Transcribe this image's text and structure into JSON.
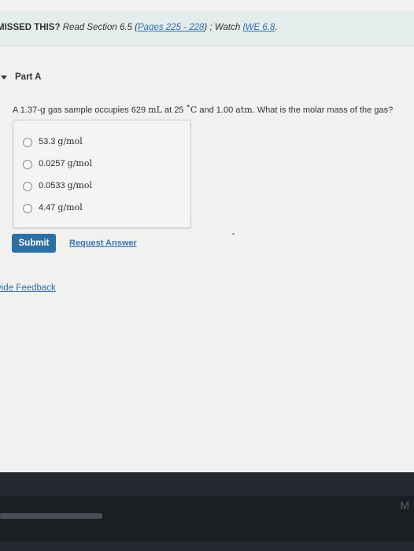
{
  "banner": {
    "missed": "MISSED THIS?",
    "read": "Read Section 6.5 (",
    "pages_link": "Pages 225 - 228",
    "close_paren": ")",
    "watch": "; Watch",
    "iwe_link": "IWE 6.8",
    "period": "."
  },
  "part": {
    "label": "Part A"
  },
  "question": {
    "prefix": "A 1.37-",
    "g": "g",
    "mid1": " gas sample occupies 629 ",
    "ml": "mL",
    "mid2": " at 25 ",
    "deg": "∘",
    "C": "C",
    "mid3": " and 1.00 ",
    "atm": "atm",
    "suffix": ". What is the molar mass of the gas?"
  },
  "choices": [
    {
      "value": "53.3",
      "unit": "g/mol"
    },
    {
      "value": "0.0257",
      "unit": "g/mol"
    },
    {
      "value": "0.0533",
      "unit": "g/mol"
    },
    {
      "value": "4.47",
      "unit": "g/mol"
    }
  ],
  "actions": {
    "submit": "Submit",
    "request_answer": "Request Answer"
  },
  "feedback": {
    "label": "vide Feedback"
  },
  "footer": {
    "corner_letter": "M"
  },
  "colors": {
    "accent": "#2c6fa4",
    "link": "#2f6fb0",
    "banner_bg": "#e4ecec"
  }
}
